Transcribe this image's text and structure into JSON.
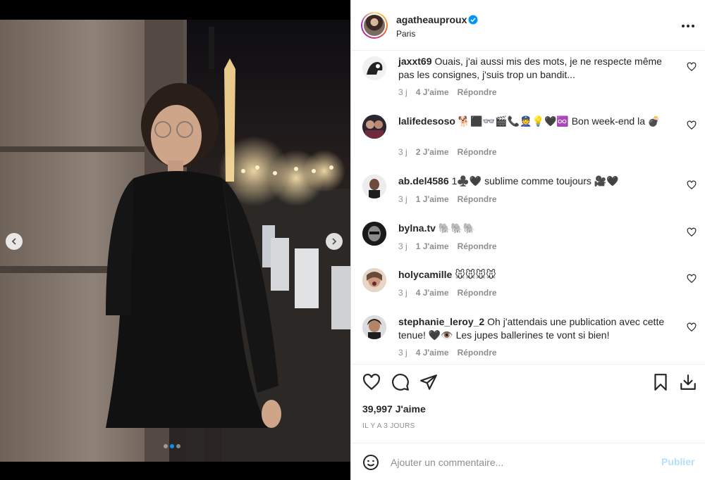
{
  "post": {
    "username": "agatheauproux",
    "location": "Paris",
    "verified": true
  },
  "comments": [
    {
      "username": "jaxxt69",
      "text": "Ouais, j'ai aussi mis des mots, je ne respecte même pas les consignes, j'suis trop un bandit...",
      "time": "3 j",
      "likes": "4 J'aime",
      "reply": "Répondre"
    },
    {
      "username": "lalifedesoso",
      "text": "🐕⬛👓🎬📞👮💡🖤♾️ Bon week-end la 💣",
      "time": "3 j",
      "likes": "2 J'aime",
      "reply": "Répondre"
    },
    {
      "username": "ab.del4586",
      "text": "1♣️🖤 sublime comme toujours 🎥🖤",
      "time": "3 j",
      "likes": "1 J'aime",
      "reply": "Répondre"
    },
    {
      "username": "bylna.tv",
      "text": "🐘🐘🐘",
      "time": "3 j",
      "likes": "1 J'aime",
      "reply": "Répondre"
    },
    {
      "username": "holycamille",
      "text": "🐭🐭🐭🐭",
      "time": "3 j",
      "likes": "4 J'aime",
      "reply": "Répondre"
    },
    {
      "username": "stephanie_leroy_2",
      "text": "Oh j'attendais une publication avec cette tenue! 🖤👁️ Les jupes ballerines te vont si bien!",
      "time": "3 j",
      "likes": "4 J'aime",
      "reply": "Répondre"
    }
  ],
  "stats": {
    "likes": "39,997 J'aime",
    "time": "IL Y A 3 JOURS"
  },
  "add_comment": {
    "placeholder": "Ajouter un commentaire...",
    "publish_label": "Publier"
  },
  "carousel": {
    "slide_count": 3,
    "active_index": 1
  },
  "icons": {
    "verified": "verified-badge-icon",
    "more": "more-options-icon",
    "like": "heart-icon",
    "comment": "comment-icon",
    "share": "paper-plane-icon",
    "save": "bookmark-icon",
    "download": "download-icon",
    "emoji": "emoji-icon"
  },
  "colors": {
    "accent": "#0095f6",
    "publish_disabled": "#b2dffc",
    "secondary_text": "#8e8e8e"
  }
}
